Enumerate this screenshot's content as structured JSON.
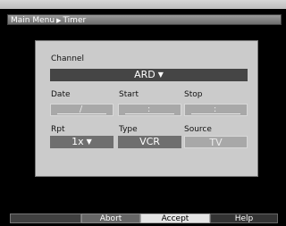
{
  "breadcrumb": {
    "parent": "Main Menu",
    "current": "Timer"
  },
  "form": {
    "channel": {
      "label": "Channel",
      "value": "ARD"
    },
    "date": {
      "label": "Date",
      "value": "/"
    },
    "start": {
      "label": "Start",
      "value": ":"
    },
    "stop": {
      "label": "Stop",
      "value": ":"
    },
    "repeat": {
      "label": "Rpt",
      "value": "1x"
    },
    "type": {
      "label": "Type",
      "value": "VCR"
    },
    "source": {
      "label": "Source",
      "value": "TV"
    }
  },
  "actions": {
    "red": "",
    "abort": "Abort",
    "accept": "Accept",
    "help": "Help"
  },
  "colors": {
    "background": "#000000",
    "panel": "#cbcbcb",
    "active_field": "#454545",
    "field": "#6f6f6f",
    "disabled_field": "#a8a8a8",
    "accept_highlight": "#e4e4e4"
  }
}
